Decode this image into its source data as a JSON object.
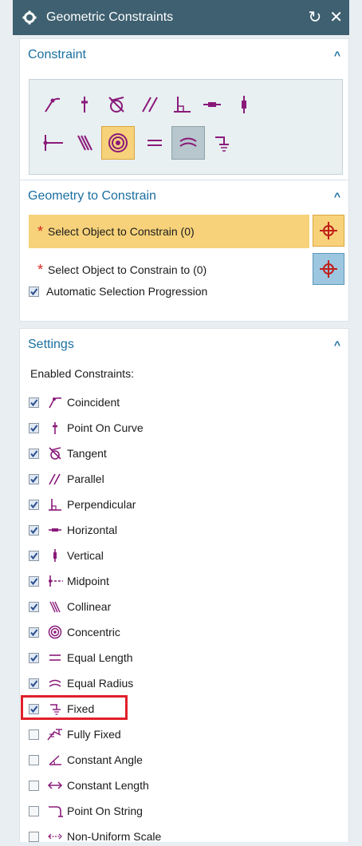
{
  "window": {
    "title": "Geometric Constraints",
    "reset_icon": "reset-icon",
    "close_icon": "close-icon"
  },
  "constraint": {
    "title": "Constraint",
    "selected_tool": "concentric",
    "hovered_tool": "equal-radius"
  },
  "geometry": {
    "title": "Geometry to Constrain",
    "select_object": "Select Object to Constrain (0)",
    "select_object_to": "Select Object to Constrain to (0)",
    "auto_progression": "Automatic Selection Progression",
    "auto_progression_checked": true
  },
  "settings": {
    "title": "Settings",
    "enabled_label": "Enabled Constraints:",
    "items": [
      {
        "label": "Coincident",
        "icon": "coincident-icon",
        "checked": true
      },
      {
        "label": "Point On Curve",
        "icon": "point-on-curve-icon",
        "checked": true
      },
      {
        "label": "Tangent",
        "icon": "tangent-icon",
        "checked": true
      },
      {
        "label": "Parallel",
        "icon": "parallel-icon",
        "checked": true
      },
      {
        "label": "Perpendicular",
        "icon": "perpendicular-icon",
        "checked": true
      },
      {
        "label": "Horizontal",
        "icon": "horizontal-icon",
        "checked": true
      },
      {
        "label": "Vertical",
        "icon": "vertical-icon",
        "checked": true
      },
      {
        "label": "Midpoint",
        "icon": "midpoint-icon",
        "checked": true
      },
      {
        "label": "Collinear",
        "icon": "collinear-icon",
        "checked": true
      },
      {
        "label": "Concentric",
        "icon": "concentric-icon",
        "checked": true
      },
      {
        "label": "Equal Length",
        "icon": "equal-length-icon",
        "checked": true
      },
      {
        "label": "Equal Radius",
        "icon": "equal-radius-icon",
        "checked": true
      },
      {
        "label": "Fixed",
        "icon": "fixed-icon",
        "checked": true
      },
      {
        "label": "Fully Fixed",
        "icon": "fully-fixed-icon",
        "checked": false
      },
      {
        "label": "Constant Angle",
        "icon": "constant-angle-icon",
        "checked": false
      },
      {
        "label": "Constant Length",
        "icon": "constant-length-icon",
        "checked": false
      },
      {
        "label": "Point On String",
        "icon": "point-on-string-icon",
        "checked": false
      },
      {
        "label": "Non-Uniform Scale",
        "icon": "non-uniform-scale-icon",
        "checked": false
      }
    ]
  },
  "colors": {
    "accent": "#1a6fa1",
    "icon": "#8a1a7a",
    "titlebar": "#3e6070",
    "highlight": "#e0202a"
  }
}
